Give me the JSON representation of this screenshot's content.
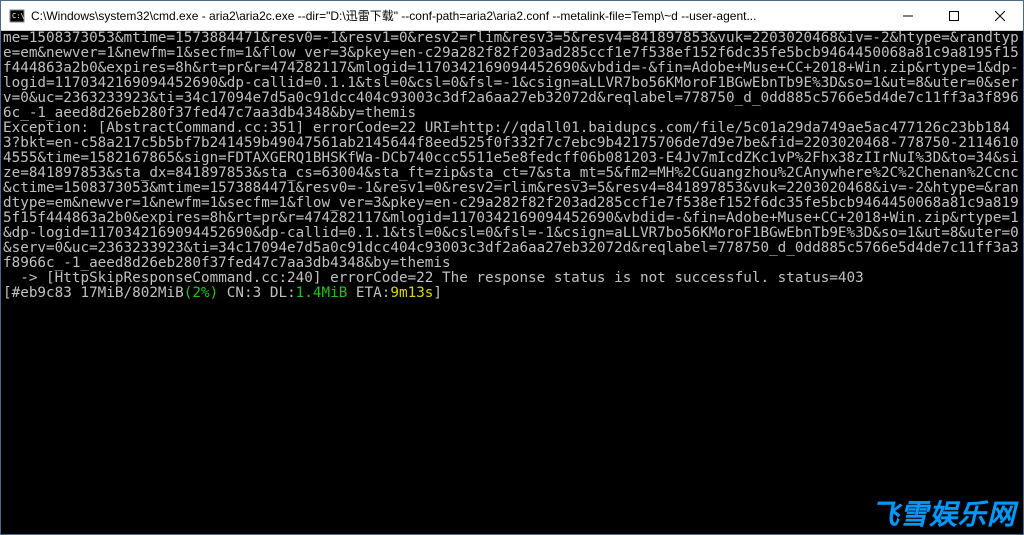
{
  "window": {
    "title": "C:\\Windows\\system32\\cmd.exe - aria2\\aria2c.exe  --dir=\"D:\\迅雷下载\" --conf-path=aria2\\aria2.conf --metalink-file=Temp\\~d --user-agent..."
  },
  "console": {
    "lines": [
      "me=1508373053&mtime=1573884471&resv0=-1&resv1=0&resv2=rlim&resv3=5&resv4=841897853&vuk=2203020468&iv=-2&htype=&randtype=em&newver=1&newfm=1&secfm=1&flow_ver=3&pkey=en-c29a282f82f203ad285ccf1e7f538ef152f6dc35fe5bcb9464450068a81c9a8195f15f444863a2b0&expires=8h&rt=pr&r=474282117&mlogid=1170342169094452690&vbdid=-&fin=Adobe+Muse+CC+2018+Win.zip&rtype=1&dp-logid=1170342169094452690&dp-callid=0.1.1&tsl=0&csl=0&fsl=-1&csign=aLLVR7bo56KMoroF1BGwEbnTb9E%3D&so=1&ut=8&uter=0&serv=0&uc=2363233923&ti=34c17094e7d5a0c91dcc404c93003c3df2a6aa27eb32072d&reqlabel=778750_d_0dd885c5766e5d4de7c11ff3a3f8966c_-1_aeed8d26eb280f37fed47c7aa3db4348&by=themis",
      "Exception: [AbstractCommand.cc:351] errorCode=22 URI=http://qdall01.baidupcs.com/file/5c01a29da749ae5ac477126c23bb1843?bkt=en-c58a217c5b5bf7b241459b49047561ab2145644f8eed525f0f332f7c7ebc9b42175706de7d9e7be&fid=2203020468-778750-21146104555&time=1582167865&sign=FDTAXGERQ1BHSKfWa-DCb740ccc5511e5e8fedcff06b081203-E4Jv7mIcdZKc1vP%2Fhx38zIIrNuI%3D&to=34&size=841897853&sta_dx=841897853&sta_cs=63004&sta_ft=zip&sta_ct=7&sta_mt=5&fm2=MH%2CGuangzhou%2CAnywhere%2C%2Chenan%2Ccnc&ctime=1508373053&mtime=1573884471&resv0=-1&resv1=0&resv2=rlim&resv3=5&resv4=841897853&vuk=2203020468&iv=-2&htype=&randtype=em&newver=1&newfm=1&secfm=1&flow_ver=3&pkey=en-c29a282f82f203ad285ccf1e7f538ef152f6dc35fe5bcb9464450068a81c9a8195f15f444863a2b0&expires=8h&rt=pr&r=474282117&mlogid=1170342169094452690&vbdid=-&fin=Adobe+Muse+CC+2018+Win.zip&rtype=1&dp-logid=1170342169094452690&dp-callid=0.1.1&tsl=0&csl=0&fsl=-1&csign=aLLVR7bo56KMoroF1BGwEbnTb9E%3D&so=1&ut=8&uter=0&serv=0&uc=2363233923&ti=34c17094e7d5a0c91dcc404c93003c3df2a6aa27eb32072d&reqlabel=778750_d_0dd885c5766e5d4de7c11ff3a3f8966c_-1_aeed8d26eb280f37fed47c7aa3db4348&by=themis",
      "  -> [HttpSkipResponseCommand.cc:240] errorCode=22 The response status is not successful. status=403"
    ],
    "status": {
      "prefix": "[#eb9c83 17MiB/802MiB",
      "percent": "(2%)",
      "mid": " CN:3 DL:",
      "dl": "1.4MiB",
      "eta_label": " ETA:",
      "eta": "9m13s",
      "suffix": "]"
    }
  },
  "watermark": "飞雪娱乐网"
}
